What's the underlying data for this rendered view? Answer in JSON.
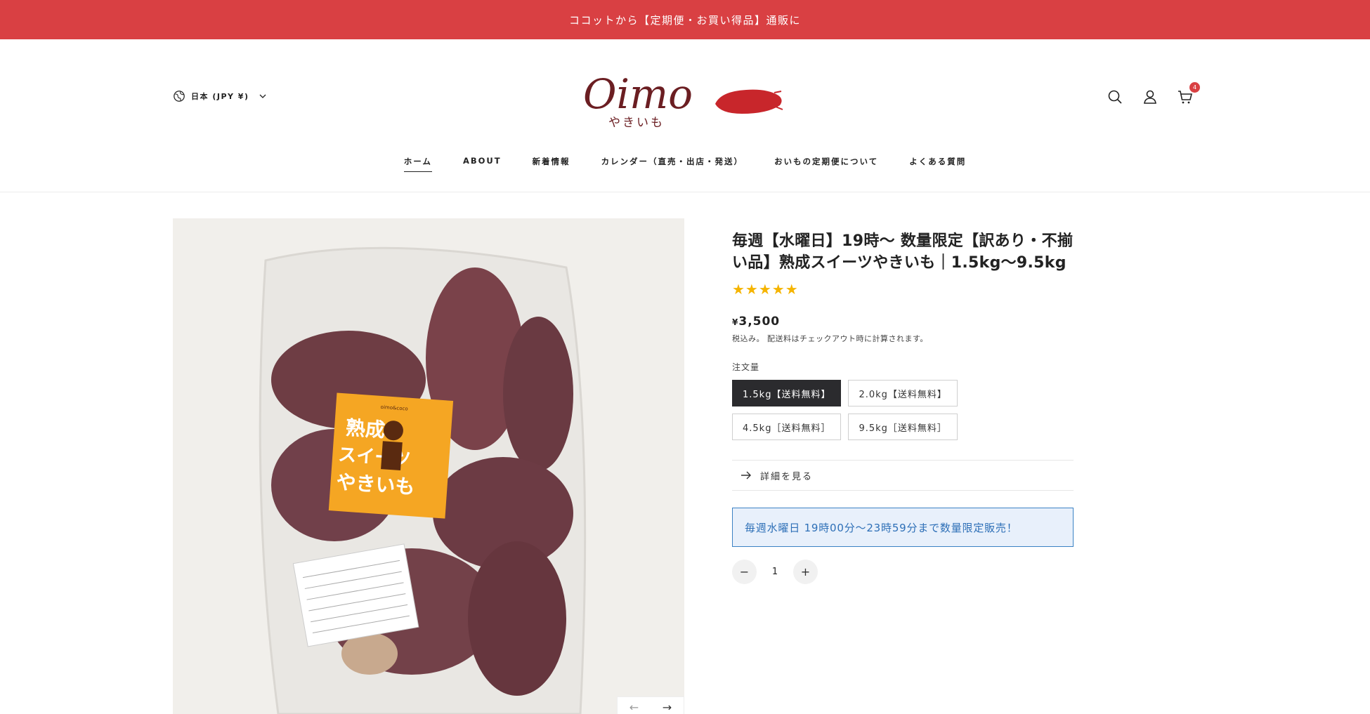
{
  "announcement": "ココットから【定期便・お買い得品】通販に",
  "header": {
    "locale": "日本 (JPY ¥)",
    "cart_count": "4",
    "logo_text": "Oimo",
    "logo_sub": "やきいも",
    "brand_color": "#d94043"
  },
  "nav": {
    "items": [
      "ホーム",
      "ABOUT",
      "新着情報",
      "カレンダー（直売・出店・発送）",
      "おいもの定期便について",
      "よくある質問"
    ]
  },
  "product": {
    "title": "毎週【水曜日】19時〜 数量限定【訳あり・不揃い品】熟成スイーツやきいも｜1.5kg〜9.5kg",
    "rating_stars": "★★★★★",
    "price_symbol": "¥",
    "price": "3,500",
    "tax_note": "税込み。 配送料はチェックアウト時に計算されます。",
    "option_label": "注文量",
    "options": [
      "1.5kg【送料無料】",
      "2.0kg【送料無料】",
      "4.5kg［送料無料］",
      "9.5kg［送料無料］"
    ],
    "selected_option": "1.5kg【送料無料】",
    "details_label": "詳細を見る",
    "notice": "毎週水曜日 19時00分〜23時59分まで数量限定販売！",
    "quantity": "1",
    "qty_minus": "−",
    "qty_plus": "+"
  },
  "image_label": {
    "brand": "oimo&coco",
    "line1": "熟成",
    "line2": "スイーツ",
    "line3": "やきいも"
  },
  "gallery": {
    "prev": "←",
    "next": "→"
  }
}
